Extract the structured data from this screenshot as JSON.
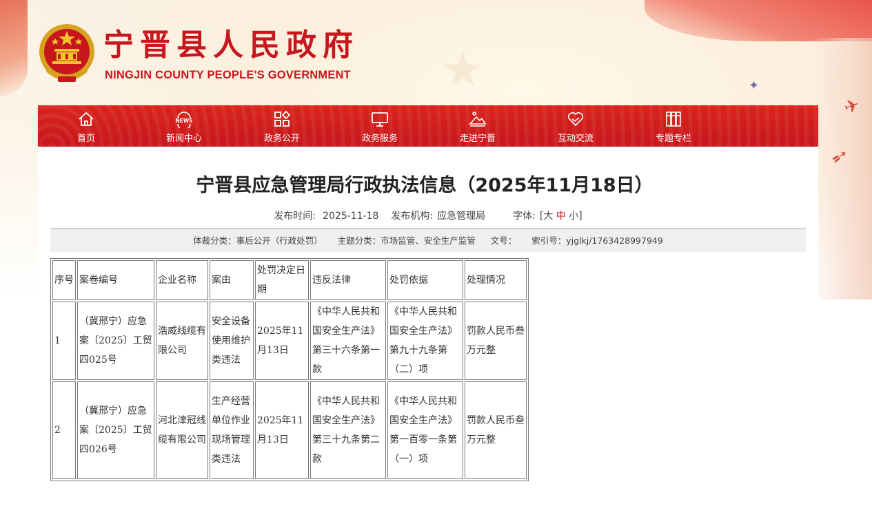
{
  "site": {
    "title": "宁晋县人民政府",
    "subtitle": "NINGJIN COUNTY PEOPLE'S GOVERNMENT"
  },
  "nav": [
    {
      "label": "首页",
      "icon": "home-icon"
    },
    {
      "label": "新闻中心",
      "icon": "news-icon"
    },
    {
      "label": "政务公开",
      "icon": "grid-icon"
    },
    {
      "label": "政务服务",
      "icon": "monitor-icon"
    },
    {
      "label": "走进宁晋",
      "icon": "mountain-icon"
    },
    {
      "label": "互动交流",
      "icon": "handshake-icon"
    },
    {
      "label": "专题专栏",
      "icon": "books-icon"
    }
  ],
  "article": {
    "title": "宁晋县应急管理局行政执法信息（2025年11月18日）",
    "publish_time_label": "发布时间:",
    "publish_time": "2025-11-18",
    "publisher_label": "发布机构:",
    "publisher": "应急管理局",
    "font_label": "字体:",
    "font_open": "[",
    "font_large": "大",
    "font_medium": "中",
    "font_small": "小",
    "font_close": "]"
  },
  "info_bar": {
    "genre": "体裁分类：事后公开（行政处罚）",
    "topic": "主题分类：市场监管、安全生产监管",
    "doc_no": "文号：",
    "index_no": "索引号：yjglkj/1763428997949"
  },
  "table": {
    "headers": [
      "序号",
      "案卷编号",
      "企业名称",
      "案由",
      "处罚决定日期",
      "违反法律",
      "处罚依据",
      "处理情况"
    ],
    "rows": [
      [
        "1",
        "（冀邢宁）应急案〔2025〕工贸四025号",
        "浩威线缆有限公司",
        "安全设备使用维护类违法",
        "2025年11月13日",
        "《中华人民共和国安全生产法》第三十六条第一款",
        "《中华人民共和国安全生产法》第九十九条第（二）项",
        "罚款人民币叁万元整"
      ],
      [
        "2",
        "（冀邢宁）应急案〔2025〕工贸四026号",
        "河北津冠线缆有限公司",
        "生产经营单位作业现场管理类违法",
        "2025年11月13日",
        "《中华人民共和国安全生产法》第三十九条第二款",
        "《中华人民共和国安全生产法》第一百零一条第（一）项",
        "罚款人民币叁万元整"
      ]
    ]
  },
  "colors": {
    "brand_red": "#c8161d",
    "nav_red": "#d9251b",
    "info_bar_bg": "#efefef"
  }
}
